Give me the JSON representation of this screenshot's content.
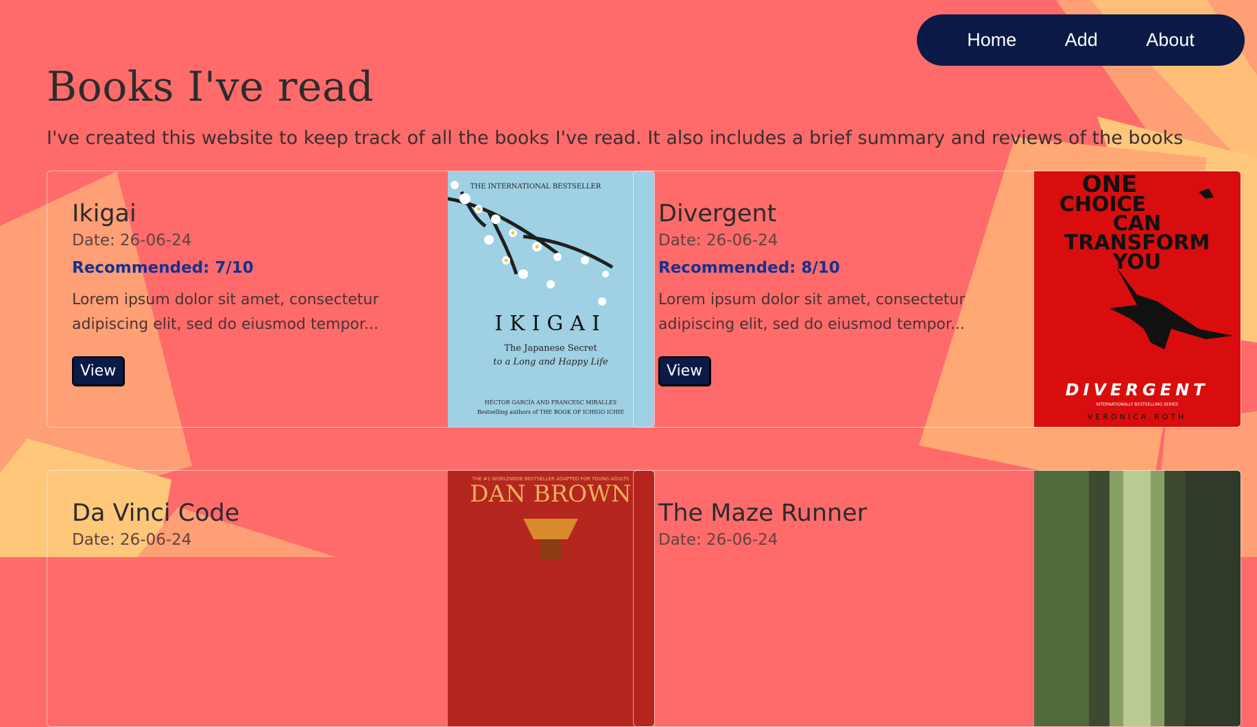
{
  "nav": {
    "home": "Home",
    "add": "Add",
    "about": "About"
  },
  "page": {
    "title": "Books I've read",
    "subtitle": "I've created this website to keep track of all the books I've read. It also includes a brief summary and reviews of the books"
  },
  "books": [
    {
      "title": "Ikigai",
      "date": "Date: 26-06-24",
      "recommended": "Recommended: 7/10",
      "description": "Lorem ipsum dolor sit amet, consectetur adipiscing elit, sed do eiusmod tempor...",
      "button": "View",
      "cover": {
        "top_line": "THE INTERNATIONAL BESTSELLER",
        "title": "IKIGAI",
        "subtitle_1": "The Japanese Secret",
        "subtitle_2": "to a Long and Happy Life",
        "authors": "HÉCTOR GARCÍA AND FRANCESC MIRALLES",
        "footer": "Bestselling authors of THE BOOK OF ICHIGO ICHIE",
        "bg": "#9fd0e3"
      }
    },
    {
      "title": "Divergent",
      "date": "Date: 26-06-24",
      "recommended": "Recommended: 8/10",
      "description": "Lorem ipsum dolor sit amet, consectetur adipiscing elit, sed do eiusmod tempor...",
      "button": "View",
      "cover": {
        "tagline_1": "ONE",
        "tagline_2": "CHOICE",
        "tagline_3": "CAN",
        "tagline_4": "TRANSFORM",
        "tagline_5": "YOU",
        "title": "DIVERGENT",
        "series": "INTERNATIONALLY BESTSELLING SERIES",
        "author": "VERONICA ROTH",
        "bg": "#d90d0d"
      }
    },
    {
      "title": "Da Vinci Code",
      "date": "Date: 26-06-24",
      "cover": {
        "top_line": "THE #1 WORLDWIDE BESTSELLER ADAPTED FOR YOUNG ADULTS",
        "author": "DAN BROWN",
        "bg": "#b5261e"
      }
    },
    {
      "title": "The Maze Runner",
      "date": "Date: 26-06-24",
      "cover": {
        "bg": "#3d4a30"
      }
    }
  ],
  "colors": {
    "background": "#ff6b6b",
    "nav": "#0b1a46",
    "recommended": "#14328f",
    "accent_shapes": [
      "#ffc77a",
      "#ff9f76"
    ]
  }
}
